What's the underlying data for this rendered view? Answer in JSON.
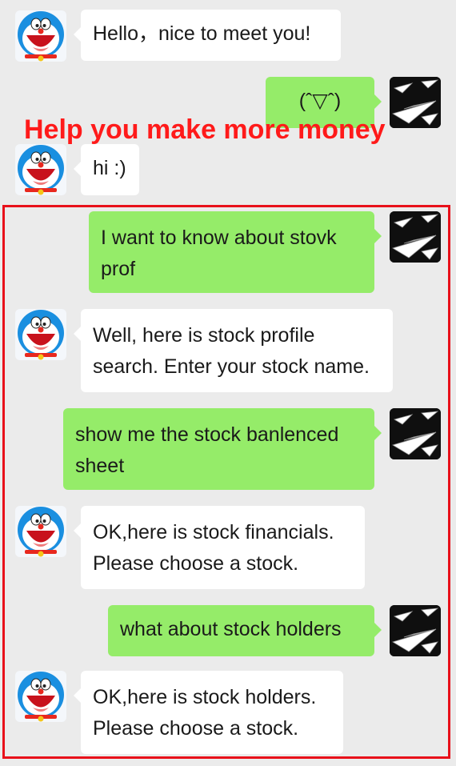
{
  "banner": "Help you make more money",
  "messages": [
    {
      "from": "bot",
      "text": "Hello，nice to meet you!"
    },
    {
      "from": "me",
      "text": "(ˆ▽ˆ)"
    },
    {
      "from": "bot",
      "text": "hi :)"
    },
    {
      "from": "me",
      "text": "I want to know about stovk prof"
    },
    {
      "from": "bot",
      "text": "Well, here is stock profile search. Enter your stock name."
    },
    {
      "from": "me",
      "text": "show me the stock banlenced sheet"
    },
    {
      "from": "bot",
      "text": "OK,here is stock financials. Please choose a stock."
    },
    {
      "from": "me",
      "text": "what about stock holders"
    },
    {
      "from": "bot",
      "text": "OK,here is stock holders. Please choose a stock."
    }
  ],
  "icons": {
    "bot_avatar": "doraemon-avatar-icon",
    "user_avatar": "paper-plane-avatar-icon"
  },
  "colors": {
    "user_bubble": "#95ec69",
    "bot_bubble": "#ffffff",
    "background": "#ebebeb",
    "highlight": "#e8101a",
    "banner": "#ff1a1a"
  }
}
